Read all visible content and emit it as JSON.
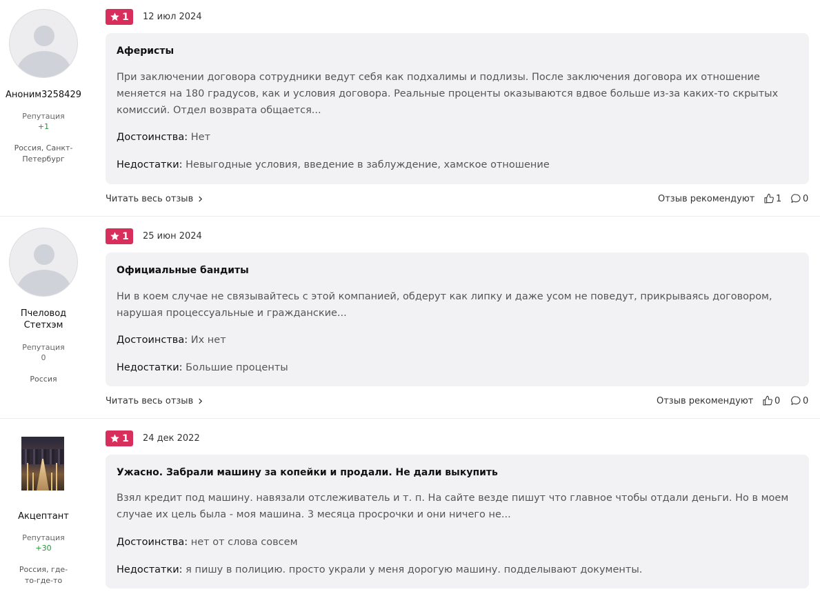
{
  "reviews": [
    {
      "author": {
        "name": "Аноним3258429",
        "reputation_label": "Репутация",
        "reputation": "+1",
        "location": "Россия, Санкт-Петербург"
      },
      "rating": "1",
      "date": "12 июл 2024",
      "title": "Аферисты",
      "text": "При заключении договора сотрудники ведут себя как подхалимы и подлизы. После заключения договора их отношение меняется на 180 градусов, как и условия договора. Реальные проценты оказываются вдвое больше из-за каких-то скрытых комиссий. Отдел возврата общается...",
      "pros_label": "Достоинства:",
      "pros": "Нет",
      "cons_label": "Недостатки:",
      "cons": "Невыгодные условия, введение в заблуждение, хамское отношение",
      "read_more": "Читать весь отзыв",
      "recommend": "Отзыв рекомендуют",
      "likes": "1",
      "comments": "0"
    },
    {
      "author": {
        "name": "Пчеловод Стетхэм",
        "reputation_label": "Репутация",
        "reputation": "0",
        "location": "Россия"
      },
      "rating": "1",
      "date": "25 июн 2024",
      "title": "Официальные бандиты",
      "text": "Ни в коем случае не связывайтесь с этой компанией, обдерут как липку и даже усом не поведут, прикрываясь договором, нарушая процессуальные и гражданские...",
      "pros_label": "Достоинства:",
      "pros": "Их нет",
      "cons_label": "Недостатки:",
      "cons": "Большие проценты",
      "read_more": "Читать весь отзыв",
      "recommend": "Отзыв рекомендуют",
      "likes": "0",
      "comments": "0"
    },
    {
      "author": {
        "name": "Акцептант",
        "reputation_label": "Репутация",
        "reputation": "+30",
        "location": "Россия, где-то-где-то"
      },
      "rating": "1",
      "date": "24 дек 2022",
      "title": "Ужасно. Забрали машину за копейки и продали. Не дали выкупить",
      "text": "Взял кредит под машину. навязали отслеживатель и т. п. На сайте везде пишут что главное чтобы отдали деньги. Но в моем случае их цель была - моя машина. 3 месяца просрочки и они ничего не...",
      "pros_label": "Достоинства:",
      "pros": "нет от слова совсем",
      "cons_label": "Недостатки:",
      "cons": "я пишу в полицию. просто украли у меня дорогую машину. подделывают документы."
    }
  ],
  "colors": {
    "rating_badge": "#d72e5b",
    "reputation_positive": "#1b9a2e",
    "card_bg": "#f2f2f4"
  },
  "icons": [
    "star-icon",
    "chevron-right-icon",
    "thumbs-up-icon",
    "comment-icon"
  ]
}
